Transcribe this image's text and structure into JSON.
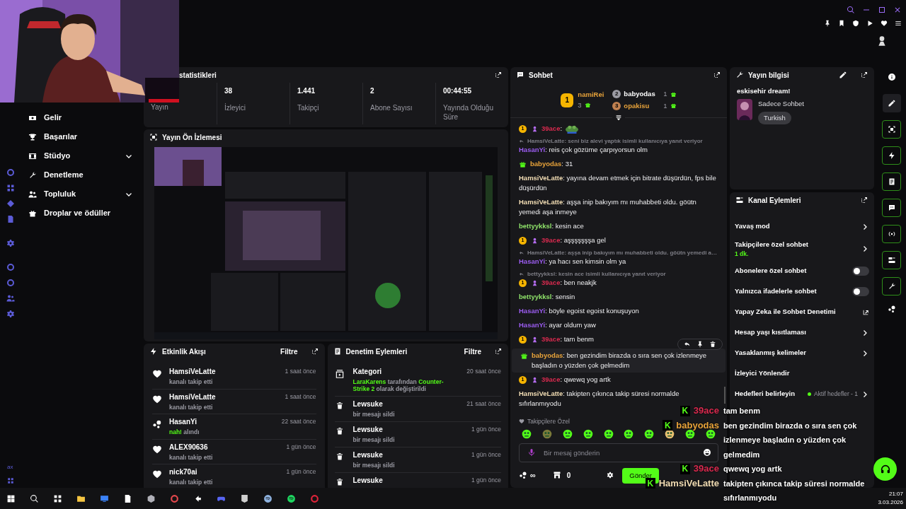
{
  "sidebar": {
    "items": [
      {
        "label": "Gelir",
        "expandable": false
      },
      {
        "label": "Başarılar",
        "expandable": false
      },
      {
        "label": "Stüdyo",
        "expandable": true
      },
      {
        "label": "Denetleme",
        "expandable": false
      },
      {
        "label": "Topluluk",
        "expandable": true
      },
      {
        "label": "Droplar ve ödüller",
        "expandable": false
      }
    ],
    "footer": "ax"
  },
  "stats_panel": {
    "title": "statistikleri",
    "stats": [
      {
        "label": "Yayın"
      },
      {
        "value": "38",
        "label": "İzleyici"
      },
      {
        "value": "1.441",
        "label": "Takipçi"
      },
      {
        "value": "2",
        "label": "Abone Sayısı"
      },
      {
        "value": "00:44:55",
        "label": "Yayında Olduğu Süre"
      }
    ]
  },
  "preview_panel": {
    "title": "Yayın Ön İzlemesi"
  },
  "activity_panel": {
    "title": "Etkinlik Akışı",
    "filter": "Filtre",
    "events": [
      {
        "kind": "follow",
        "user": "HamsiVeLatte",
        "text": "kanalı takip etti",
        "time": "1 saat önce"
      },
      {
        "kind": "follow",
        "user": "HamsiVeLatte",
        "text": "kanalı takip etti",
        "time": "1 saat önce"
      },
      {
        "kind": "redeem",
        "user": "HasanYi",
        "reward": "nah!",
        "text": "alındı",
        "time": "22 saat önce"
      },
      {
        "kind": "follow",
        "user": "ALEX90636",
        "text": "kanalı takip etti",
        "time": "1 gün önce"
      },
      {
        "kind": "follow",
        "user": "nick70ai",
        "text": "kanalı takip etti",
        "time": "1 gün önce"
      }
    ]
  },
  "moderation_panel": {
    "title": "Denetim Eylemleri",
    "filter": "Filtre",
    "actions": [
      {
        "kind": "category",
        "title": "Kategori",
        "time": "20 saat önce",
        "parts": [
          {
            "text": "LaraKarens",
            "highlight": true
          },
          {
            "text": "tarafından",
            "highlight": false
          },
          {
            "text": "Counter-Strike 2",
            "highlight": true
          },
          {
            "text": "olarak değiştirildi",
            "highlight": false
          }
        ]
      },
      {
        "kind": "delete",
        "title": "Lewsuke",
        "time": "21 saat önce",
        "parts": [
          {
            "text": "bir mesajı sildi",
            "highlight": false
          }
        ]
      },
      {
        "kind": "delete",
        "title": "Lewsuke",
        "time": "1 gün önce",
        "parts": [
          {
            "text": "bir mesajı sildi",
            "highlight": false
          }
        ]
      },
      {
        "kind": "delete",
        "title": "Lewsuke",
        "time": "1 gün önce",
        "parts": [
          {
            "text": "bir mesajı sildi",
            "highlight": false
          }
        ]
      },
      {
        "kind": "delete",
        "title": "Lewsuke",
        "time": "1 gün önce"
      }
    ]
  },
  "chat": {
    "title": "Sohbet",
    "leaderboard": [
      {
        "rank": "1",
        "user": "namiRei",
        "gifts": "3",
        "color": "#e8a33a"
      },
      {
        "rank": "2",
        "user": "babyodas",
        "gifts": "1",
        "color": "#ffffff"
      },
      {
        "rank": "3",
        "user": "opakisu",
        "gifts": "1",
        "color": "#e8a33a"
      }
    ],
    "messages": [
      {
        "badges": [
          {
            "kind": "rank",
            "text": "1"
          },
          {
            "kind": "figure"
          }
        ],
        "user": "39ace",
        "color": "#d92a4f",
        "text": ":",
        "emote": true,
        "hovered": false
      },
      {
        "reply": "HamsiVeLatte: seni biz alevi yaptık isimli kullanıcıya yanıt veriyor",
        "user": "HasanYi",
        "color": "#9b5cf0",
        "text": ": reis çok gözüme çarpıyorsun olm",
        "hovered": false
      },
      {
        "badges": [
          {
            "kind": "gift"
          }
        ],
        "user": "babyodas",
        "color": "#e8a33a",
        "text": ": 31",
        "hovered": false
      },
      {
        "user": "HamsiVeLatte",
        "color": "#f2ddb4",
        "text": ": yayına devam etmek için bitrate düşürdün, fps bile düşürdün",
        "hovered": false
      },
      {
        "user": "HamsiVeLatte",
        "color": "#f2ddb4",
        "text": ": aşşa inip bakıyım mı muhabbeti oldu. göütn yemedi aşa inmeye",
        "hovered": false
      },
      {
        "user": "bettyykksl",
        "color": "#8fe36a",
        "text": ": kesin ace",
        "hovered": false
      },
      {
        "badges": [
          {
            "kind": "rank",
            "text": "1"
          },
          {
            "kind": "figure"
          }
        ],
        "user": "39ace",
        "color": "#d92a4f",
        "text": ": aşşşşşşşa gel",
        "hovered": false
      },
      {
        "reply": "HamsiVeLatte: aşşa inip bakıyım mı muhabbeti oldu. göütn yemedi a…",
        "user": "HasanYi",
        "color": "#9b5cf0",
        "text": ": ya hacı sen kimsin olm ya",
        "hovered": false
      },
      {
        "reply": "bettyykksl: kesin ace isimli kullanıcıya yanıt veriyor",
        "badges": [
          {
            "kind": "rank",
            "text": "1"
          },
          {
            "kind": "figure"
          }
        ],
        "user": "39ace",
        "color": "#d92a4f",
        "text": ": ben neakjk",
        "hovered": false
      },
      {
        "user": "bettyykksl",
        "color": "#8fe36a",
        "text": ": sensin",
        "hovered": false
      },
      {
        "user": "HasanYi",
        "color": "#9b5cf0",
        "text": ": böyle egoist egoist konuşuyon",
        "hovered": false
      },
      {
        "user": "HasanYi",
        "color": "#9b5cf0",
        "text": ": ayar oldum yaw",
        "hovered": false
      },
      {
        "badges": [
          {
            "kind": "rank",
            "text": "1"
          },
          {
            "kind": "figure"
          }
        ],
        "user": "39ace",
        "color": "#d92a4f",
        "text": ": tam benm",
        "hovered": false
      },
      {
        "badges": [
          {
            "kind": "gift"
          }
        ],
        "user": "babyodas",
        "color": "#e8a33a",
        "text": ": ben gezindim birazda o sıra sen çok izlenmeye başladın o yüzden çok gelmedim",
        "hovered": true
      },
      {
        "badges": [
          {
            "kind": "rank",
            "text": "1"
          },
          {
            "kind": "figure"
          }
        ],
        "user": "39ace",
        "color": "#d92a4f",
        "text": ": qwewq yog artk",
        "hovered": false
      },
      {
        "user": "HamsiVeLatte",
        "color": "#f2ddb4",
        "text": ": takipten çıkınca takip süresi normalde sıfırlanmıyodu",
        "hovered": false
      }
    ],
    "mode_label": "Takipçilere Özel",
    "input": {
      "placeholder": "Bir mesaj gönderin"
    },
    "points": "∞",
    "store_count": "0",
    "send": "Gönder"
  },
  "stream_info": {
    "title": "Yayın bilgisi",
    "stream_title": "eskisehir dream!",
    "category": "Sadece Sohbet",
    "tags": [
      "Turkish"
    ]
  },
  "channel_actions": {
    "title": "Kanal Eylemleri",
    "items": [
      {
        "label": "Yavaş mod",
        "kind": "chevron"
      },
      {
        "label": "Takipçilere özel sohbet",
        "kind": "chevron",
        "sub": "1 dk."
      },
      {
        "label": "Abonelere özel sohbet",
        "kind": "toggle",
        "on": false
      },
      {
        "label": "Yalnızca ifadelerle sohbet",
        "kind": "toggle",
        "on": false
      },
      {
        "label": "Yapay Zeka ile Sohbet Denetimi",
        "kind": "external"
      },
      {
        "label": "Hesap yaşı kısıtlaması",
        "kind": "chevron"
      },
      {
        "label": "Yasaklanmış kelimeler",
        "kind": "chevron"
      },
      {
        "label": "İzleyici Yönlendir",
        "kind": "plain"
      },
      {
        "label": "Hedefleri belirleyin",
        "kind": "goal",
        "status": "Aktif hedefler - 1"
      }
    ]
  },
  "stream_overlay": {
    "messages": [
      {
        "badge": "K",
        "user": "39ace",
        "color": "#d92a4f",
        "text": "tam benm"
      },
      {
        "badge": "K",
        "user": "babyodas",
        "color": "#e8a33a",
        "text": "ben gezindim birazda o sıra sen çok izlenmeye başladın o yüzden çok gelmedim"
      },
      {
        "badge": "K",
        "user": "39ace",
        "color": "#d92a4f",
        "text": "qwewq yog artk"
      },
      {
        "badge": "K",
        "user": "HamsiVeLatte",
        "color": "#f2ddb4",
        "text": "takipten çıkınca takip süresi normalde sıfırlanmıyodu"
      }
    ]
  },
  "taskbar": {
    "time": "21:07",
    "date": "3.03.2026"
  }
}
